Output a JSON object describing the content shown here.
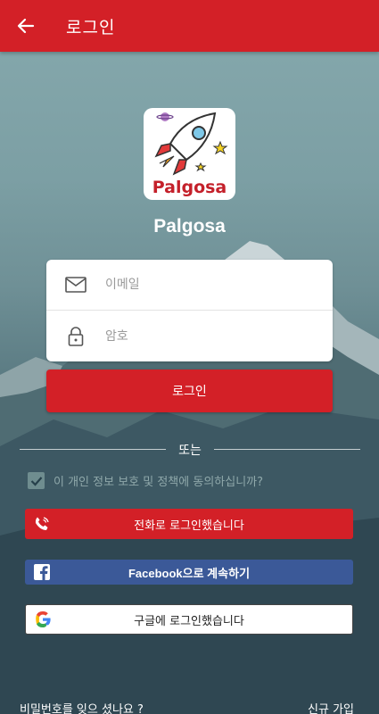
{
  "appbar": {
    "title": "로그인",
    "back_icon": "arrow-left-icon"
  },
  "logo": {
    "text": "Palgosa",
    "icon": "rocket-icon"
  },
  "app_name": "Palgosa",
  "form": {
    "email_placeholder": "이메일",
    "password_placeholder": "암호",
    "email_icon": "mail-icon",
    "password_icon": "lock-icon"
  },
  "login_button": "로그인",
  "or_text": "또는",
  "consent": {
    "text": "이 개인 정보 보호 및 정책에 동의하십니까?",
    "checked": true
  },
  "social": {
    "phone_label": "전화로 로그인했습니다",
    "facebook_label": "Facebook으로 계속하기",
    "google_label": "구글에 로그인했습니다"
  },
  "footer": {
    "forgot": "비밀번호를 잊으 셨나요 ?",
    "signup": "신규 가입"
  },
  "colors": {
    "primary": "#d32027",
    "facebook": "#3b5998",
    "white": "#ffffff"
  }
}
